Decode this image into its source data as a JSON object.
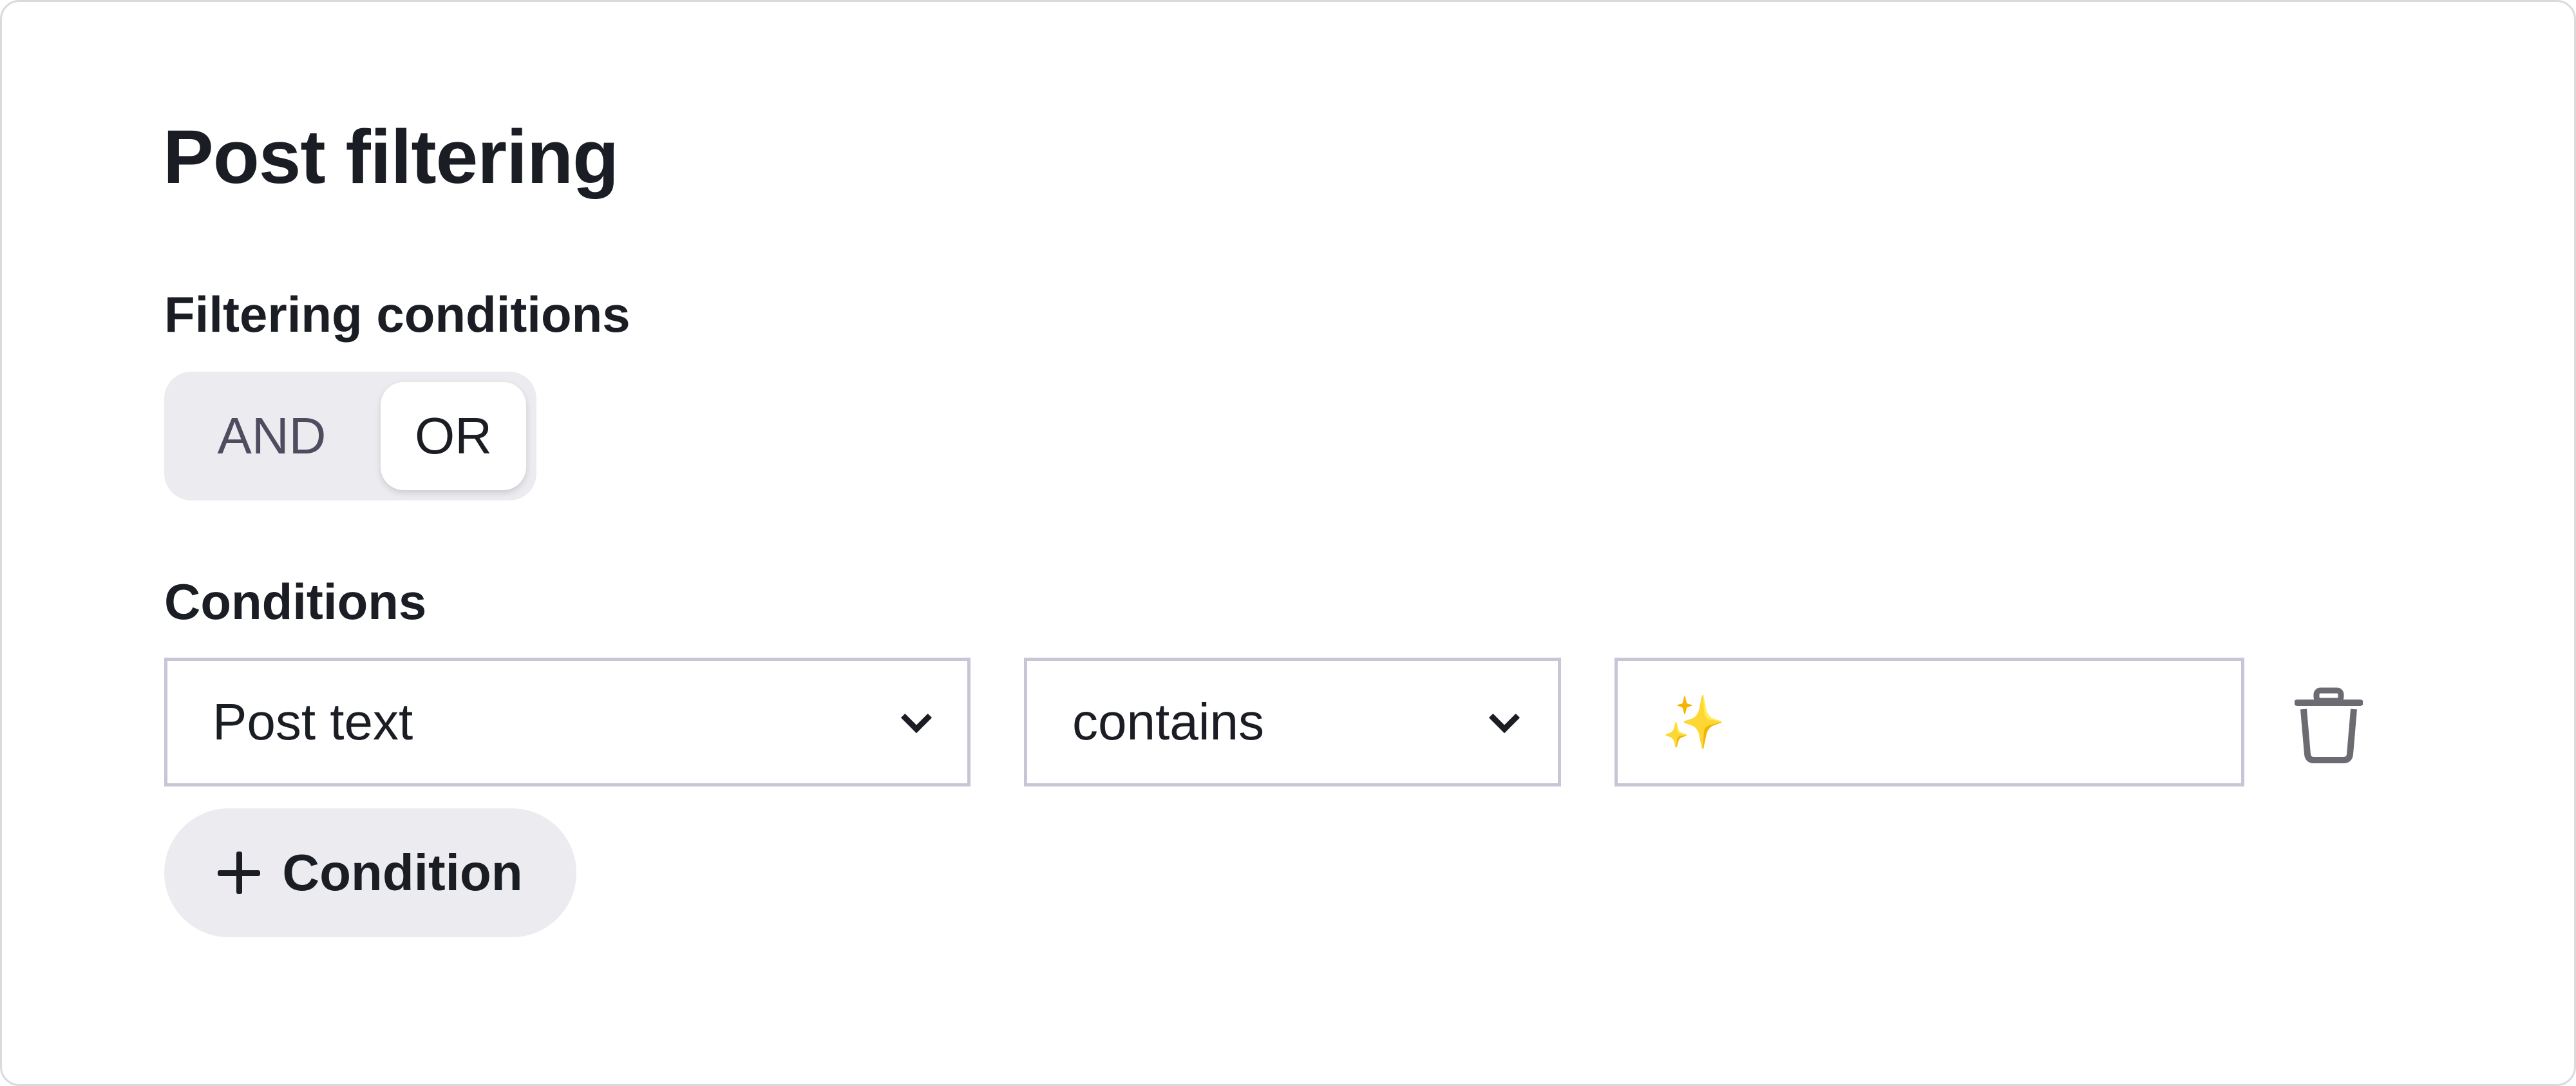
{
  "panel": {
    "title": "Post filtering"
  },
  "filtering": {
    "label": "Filtering conditions",
    "options": [
      "AND",
      "OR"
    ],
    "selected": "OR"
  },
  "conditions": {
    "label": "Conditions",
    "rows": [
      {
        "attribute": "Post text",
        "operator": "contains",
        "value_placeholder": "✨",
        "value": ""
      }
    ],
    "add_button_label": "Condition"
  },
  "icons": {
    "attribute_dropdown": "chevron-down-icon",
    "operator_dropdown": "chevron-down-icon",
    "delete": "trash-icon",
    "add": "plus-icon"
  },
  "colors": {
    "text": "#1b1d24",
    "segment_bg": "#ececf0",
    "field_border": "#c8c6d6",
    "icon_gray": "#6c6b72"
  }
}
